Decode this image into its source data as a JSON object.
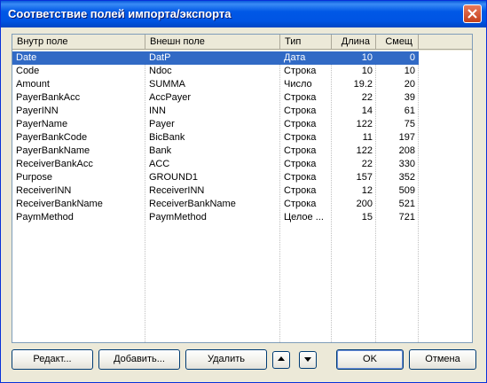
{
  "window": {
    "title": "Соответствие полей импорта/экспорта"
  },
  "columns": [
    "Внутр поле",
    "Внешн поле",
    "Тип",
    "Длина",
    "Смещ"
  ],
  "rows": [
    {
      "internal": "Date",
      "external": "DatP",
      "type": "Дата",
      "length": "10",
      "offset": "0",
      "selected": true
    },
    {
      "internal": "Code",
      "external": "Ndoc",
      "type": "Строка",
      "length": "10",
      "offset": "10"
    },
    {
      "internal": "Amount",
      "external": "SUMMA",
      "type": "Число",
      "length": "19.2",
      "offset": "20"
    },
    {
      "internal": "PayerBankAcc",
      "external": "AccPayer",
      "type": "Строка",
      "length": "22",
      "offset": "39"
    },
    {
      "internal": "PayerINN",
      "external": "INN",
      "type": "Строка",
      "length": "14",
      "offset": "61"
    },
    {
      "internal": "PayerName",
      "external": "Payer",
      "type": "Строка",
      "length": "122",
      "offset": "75"
    },
    {
      "internal": "PayerBankCode",
      "external": "BicBank",
      "type": "Строка",
      "length": "11",
      "offset": "197"
    },
    {
      "internal": "PayerBankName",
      "external": "Bank",
      "type": "Строка",
      "length": "122",
      "offset": "208"
    },
    {
      "internal": "ReceiverBankAcc",
      "external": "ACC",
      "type": "Строка",
      "length": "22",
      "offset": "330"
    },
    {
      "internal": "Purpose",
      "external": "GROUND1",
      "type": "Строка",
      "length": "157",
      "offset": "352"
    },
    {
      "internal": "ReceiverINN",
      "external": "ReceiverINN",
      "type": "Строка",
      "length": "12",
      "offset": "509"
    },
    {
      "internal": "ReceiverBankName",
      "external": "ReceiverBankName",
      "type": "Строка",
      "length": "200",
      "offset": "521"
    },
    {
      "internal": "PaymMethod",
      "external": "PaymMethod",
      "type": "Целое ...",
      "length": "15",
      "offset": "721"
    }
  ],
  "buttons": {
    "edit": "Редакт...",
    "add": "Добавить...",
    "delete": "Удалить",
    "up_icon": "arrow-up-icon",
    "down_icon": "arrow-down-icon",
    "ok": "OK",
    "cancel": "Отмена"
  },
  "colors": {
    "selection": "#316ac5",
    "titlebar": "#0054e3"
  }
}
